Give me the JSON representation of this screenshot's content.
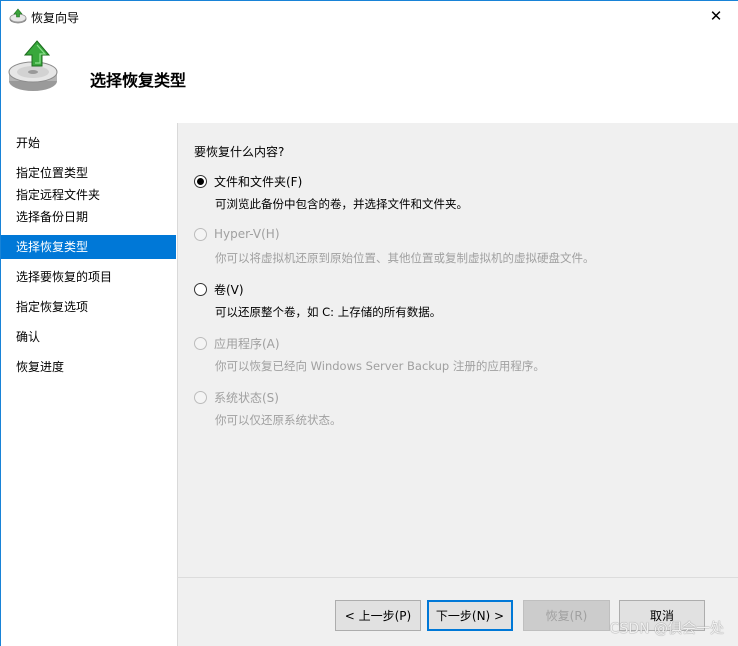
{
  "window": {
    "title": "恢复向导",
    "close_glyph": "✕"
  },
  "header": {
    "title": "选择恢复类型",
    "icon": "backup-restore-icon"
  },
  "sidebar": {
    "items": [
      {
        "label": "开始",
        "active": false
      },
      {
        "label": "指定位置类型",
        "active": false
      },
      {
        "label": "指定远程文件夹",
        "active": false
      },
      {
        "label": "选择备份日期",
        "active": false
      },
      {
        "label": "选择恢复类型",
        "active": true
      },
      {
        "label": "选择要恢复的项目",
        "active": false
      },
      {
        "label": "指定恢复选项",
        "active": false
      },
      {
        "label": "确认",
        "active": false
      },
      {
        "label": "恢复进度",
        "active": false
      }
    ]
  },
  "main": {
    "question": "要恢复什么内容?",
    "options": [
      {
        "label": "文件和文件夹(F)",
        "desc": "可浏览此备份中包含的卷，并选择文件和文件夹。",
        "checked": true,
        "enabled": true
      },
      {
        "label": "Hyper-V(H)",
        "desc": "你可以将虚拟机还原到原始位置、其他位置或复制虚拟机的虚拟硬盘文件。",
        "checked": false,
        "enabled": false
      },
      {
        "label": "卷(V)",
        "desc": "可以还原整个卷，如 C: 上存储的所有数据。",
        "checked": false,
        "enabled": true
      },
      {
        "label": "应用程序(A)",
        "desc": "你可以恢复已经向 Windows Server Backup 注册的应用程序。",
        "checked": false,
        "enabled": false
      },
      {
        "label": "系统状态(S)",
        "desc": "你可以仅还原系统状态。",
        "checked": false,
        "enabled": false
      }
    ]
  },
  "footer": {
    "prev_label": "< 上一步(P)",
    "next_label": "下一步(N) >",
    "recover_label": "恢复(R)",
    "cancel_label": "取消"
  },
  "watermark": "CSDN @俱会一处",
  "colors": {
    "accent": "#0078d7",
    "panel_bg": "#f0f0f0",
    "disabled_text": "#a0a0a0"
  }
}
